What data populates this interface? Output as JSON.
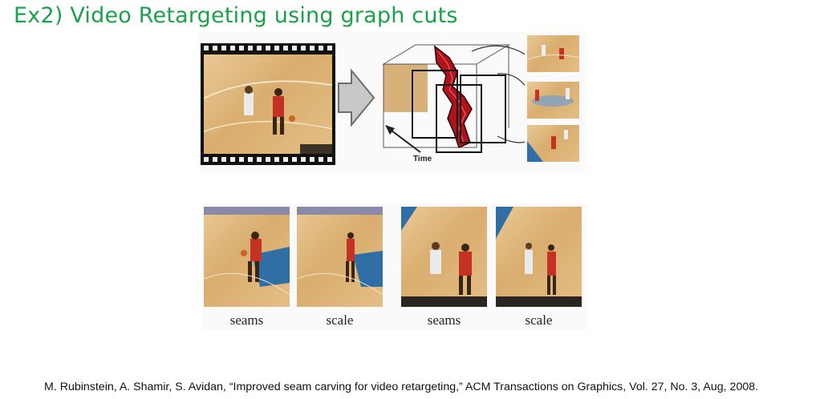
{
  "slide": {
    "title": "Ex2) Video Retargeting using graph cuts",
    "citation": "M. Rubinstein, A. Shamir, S. Avidan, “Improved seam carving for video retargeting,” ACM Transactions on Graphics, Vol. 27, No. 3, Aug, 2008."
  },
  "figure": {
    "time_label": "Time",
    "captions": [
      "seams",
      "scale",
      "seams",
      "scale"
    ]
  },
  "colors": {
    "title": "#1aa24a",
    "court": "#dcb274",
    "seam": "#b2121e",
    "paint": "#2f6fa5"
  }
}
